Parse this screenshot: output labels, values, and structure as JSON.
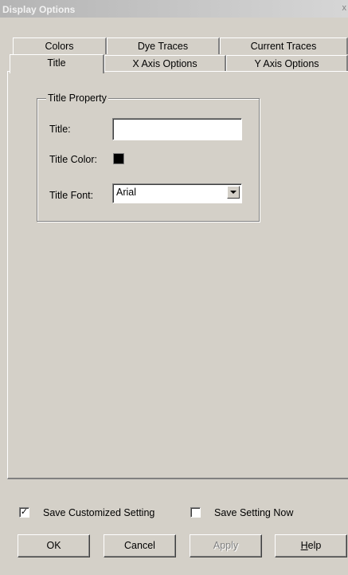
{
  "window": {
    "title": "Display Options",
    "close_glyph": "x"
  },
  "tabs": {
    "row1": [
      "Colors",
      "Dye Traces",
      "Current Traces"
    ],
    "row2": [
      "Title",
      "X Axis Options",
      "Y Axis Options"
    ],
    "active": "Title"
  },
  "title_property": {
    "group_label": "Title Property",
    "title_label": "Title:",
    "title_value": "",
    "color_label": "Title Color:",
    "color_value": "#000000",
    "font_label": "Title Font:",
    "font_value": "Arial"
  },
  "footer": {
    "save_customized": {
      "label": "Save Customized Setting",
      "checked": true,
      "mark": "✓"
    },
    "save_now": {
      "label": "Save Setting Now",
      "checked": false
    },
    "buttons": {
      "ok": "OK",
      "cancel": "Cancel",
      "apply": "Apply",
      "help_first": "H",
      "help_rest": "elp"
    }
  }
}
